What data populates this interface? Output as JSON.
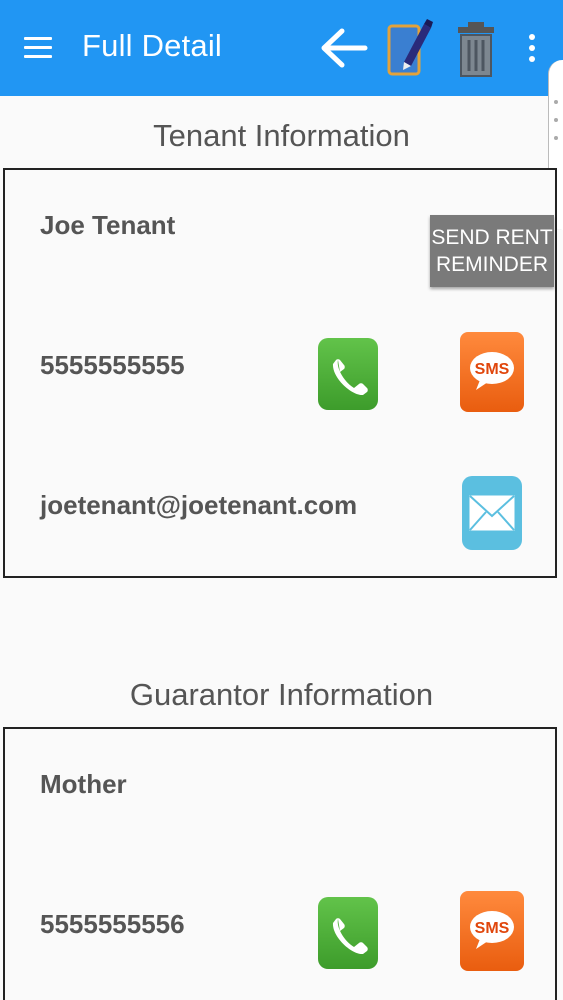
{
  "appbar": {
    "title": "Full Detail",
    "icons": [
      "menu-icon",
      "back-arrow-icon",
      "edit-note-icon",
      "trash-icon",
      "more-vert-icon"
    ],
    "color": "#2196f3"
  },
  "tenant": {
    "section_title": "Tenant Information",
    "name": "Joe Tenant",
    "reminder_line1": "SEND RENT",
    "reminder_line2": "REMINDER",
    "phone": "5555555555",
    "email": "joetenant@joetenant.com"
  },
  "guarantor": {
    "section_title": "Guarantor Information",
    "name": "Mother",
    "phone": "5555555556"
  },
  "sms_label": "SMS",
  "colors": {
    "phone": "#4caf36",
    "sms": "#f57023",
    "mail": "#5bbfe0",
    "reminder": "#7a7a7a"
  }
}
